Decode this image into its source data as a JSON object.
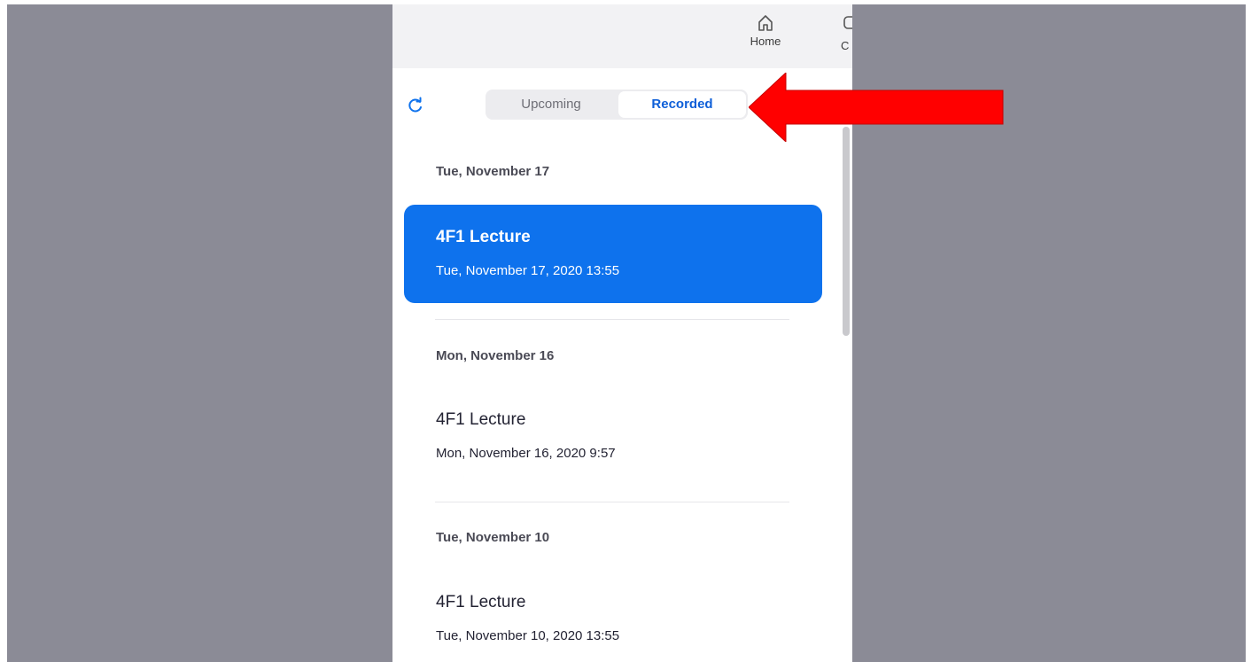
{
  "nav": {
    "home_label": "Home",
    "chat_label": "C"
  },
  "tabs": {
    "upcoming": "Upcoming",
    "recorded": "Recorded",
    "active": "Recorded"
  },
  "groups": [
    {
      "date": "Tue, November 17",
      "title": "4F1 Lecture",
      "time": "Tue, November 17, 2020 13:55",
      "selected": true
    },
    {
      "date": "Mon, November 16",
      "title": "4F1 Lecture",
      "time": "Mon, November 16, 2020 9:57",
      "selected": false
    },
    {
      "date": "Tue, November 10",
      "title": "4F1 Lecture",
      "time": "Tue, November 10, 2020 13:55",
      "selected": false
    }
  ],
  "colors": {
    "accent": "#0e72ed",
    "annotation_arrow": "#ff0000",
    "backdrop": "#8b8b96"
  },
  "icons": [
    "home-icon",
    "chat-icon",
    "refresh-icon"
  ]
}
